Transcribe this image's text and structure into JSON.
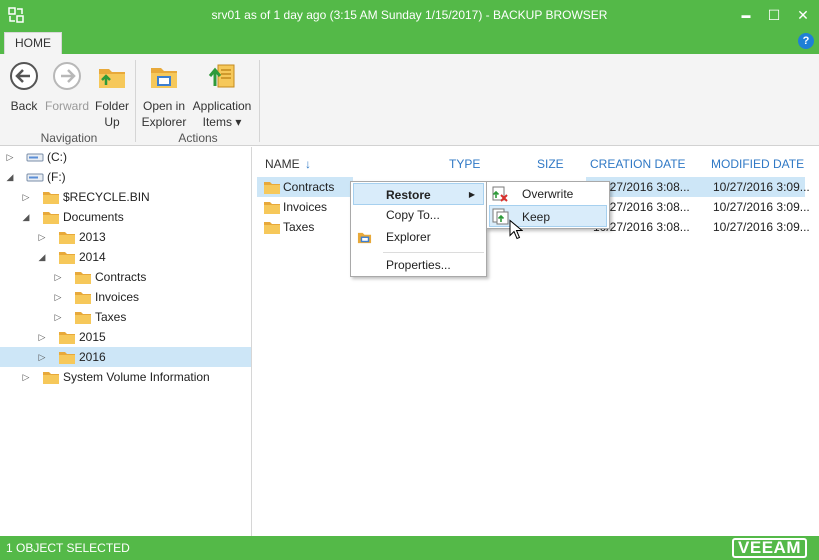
{
  "window": {
    "title": "srv01 as of 1 day ago (3:15 AM Sunday 1/15/2017) - BACKUP BROWSER",
    "minimize_glyph": "▬",
    "maximize_glyph": "☐",
    "close_glyph": "✕"
  },
  "ribbon": {
    "tab": "HOME",
    "help": "?",
    "groups": {
      "navigation": "Navigation",
      "actions": "Actions"
    },
    "buttons": {
      "back": "Back",
      "forward": "Forward",
      "folder_up_1": "Folder",
      "folder_up_2": "Up",
      "open_explorer_1": "Open in",
      "open_explorer_2": "Explorer",
      "app_items_1": "Application",
      "app_items_2": "Items ▾"
    }
  },
  "tree": {
    "items": [
      {
        "label": "(C:)"
      },
      {
        "label": "(F:)"
      },
      {
        "label": "$RECYCLE.BIN"
      },
      {
        "label": "Documents"
      },
      {
        "label": "2013"
      },
      {
        "label": "2014"
      },
      {
        "label": "Contracts"
      },
      {
        "label": "Invoices"
      },
      {
        "label": "Taxes"
      },
      {
        "label": "2015"
      },
      {
        "label": "2016"
      },
      {
        "label": "System Volume Information"
      }
    ]
  },
  "list": {
    "columns": {
      "name": "NAME",
      "type": "TYPE",
      "size": "SIZE",
      "creation": "CREATION DATE",
      "modified": "MODIFIED DATE"
    },
    "sort_arrow": "↓",
    "rows": [
      {
        "name": "Contracts",
        "created": "10/27/2016 3:08...",
        "modified": "10/27/2016 3:09..."
      },
      {
        "name": "Invoices",
        "created": "10/27/2016 3:08...",
        "modified": "10/27/2016 3:09..."
      },
      {
        "name": "Taxes",
        "created": "10/27/2016 3:08...",
        "modified": "10/27/2016 3:09..."
      }
    ]
  },
  "context_menu": {
    "restore": "Restore",
    "copy_to": "Copy To...",
    "explorer": "Explorer",
    "properties": "Properties..."
  },
  "submenu": {
    "overwrite": "Overwrite",
    "keep": "Keep"
  },
  "status": {
    "text": "1 OBJECT SELECTED",
    "logo": "VEEAM"
  },
  "colors": {
    "accent_green": "#54b948",
    "selection_blue": "#cde6f7",
    "header_blue": "#2f78c5",
    "folder_yellow": "#f2c14e"
  }
}
